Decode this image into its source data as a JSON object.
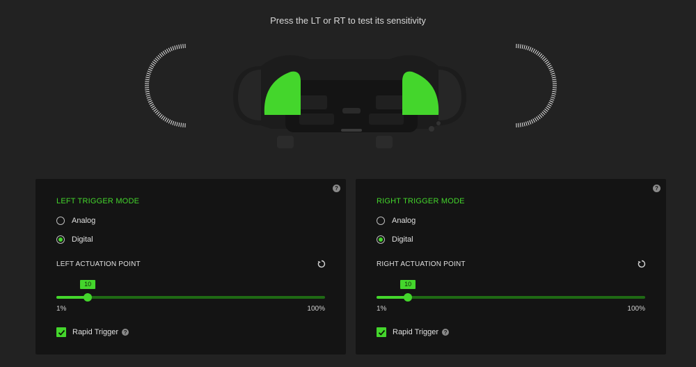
{
  "header": {
    "instruction": "Press the LT or RT to test its sensitivity"
  },
  "controller": {
    "accent_color": "#44d62c",
    "body_color": "#1c1c1c",
    "left_gauge_level": 0,
    "right_gauge_level": 0
  },
  "panels": [
    {
      "help_symbol": "?",
      "mode_title": "LEFT TRIGGER MODE",
      "options": [
        "Analog",
        "Digital"
      ],
      "selected_option": "Digital",
      "actuation_label": "LEFT ACTUATION POINT",
      "slider": {
        "value": 10,
        "value_text": "10",
        "min_label": "1%",
        "max_label": "100%",
        "min": 1,
        "max": 100
      },
      "rapid_trigger": {
        "label": "Rapid Trigger",
        "checked": true,
        "help_symbol": "?"
      }
    },
    {
      "help_symbol": "?",
      "mode_title": "RIGHT TRIGGER MODE",
      "options": [
        "Analog",
        "Digital"
      ],
      "selected_option": "Digital",
      "actuation_label": "RIGHT ACTUATION POINT",
      "slider": {
        "value": 10,
        "value_text": "10",
        "min_label": "1%",
        "max_label": "100%",
        "min": 1,
        "max": 100
      },
      "rapid_trigger": {
        "label": "Rapid Trigger",
        "checked": true,
        "help_symbol": "?"
      }
    }
  ],
  "colors": {
    "accent": "#44d62c",
    "accent_dark": "#1f6a14",
    "background": "#222222",
    "panel": "#141414"
  }
}
